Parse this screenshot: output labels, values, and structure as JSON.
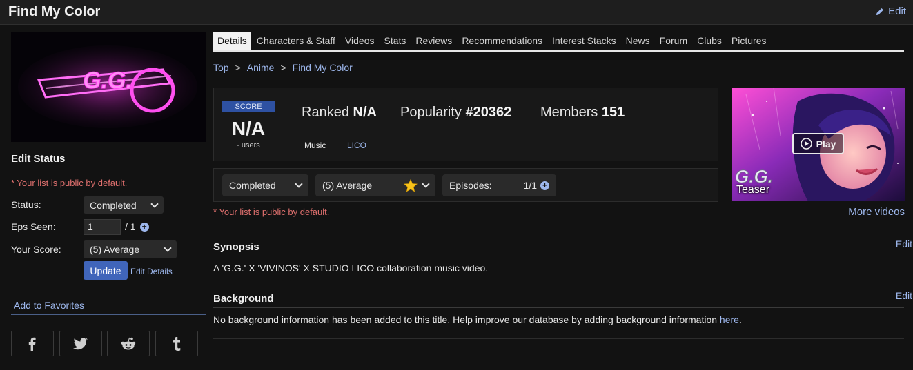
{
  "header": {
    "title": "Find My Color",
    "edit_label": "Edit"
  },
  "sidebar": {
    "edit_status_heading": "Edit Status",
    "public_note": "* Your list is public by default.",
    "status_label": "Status:",
    "status_value": "Completed",
    "eps_label": "Eps Seen:",
    "eps_value": "1",
    "eps_total": "/ 1",
    "score_label": "Your Score:",
    "score_value": "(5) Average",
    "update_label": "Update",
    "edit_details_label": "Edit Details",
    "add_favorites_label": "Add to Favorites",
    "cover_logo_text": "G.G."
  },
  "tabs": [
    {
      "label": "Details",
      "active": true
    },
    {
      "label": "Characters & Staff"
    },
    {
      "label": "Videos"
    },
    {
      "label": "Stats"
    },
    {
      "label": "Reviews"
    },
    {
      "label": "Recommendations"
    },
    {
      "label": "Interest Stacks"
    },
    {
      "label": "News"
    },
    {
      "label": "Forum"
    },
    {
      "label": "Clubs"
    },
    {
      "label": "Pictures"
    }
  ],
  "breadcrumb": {
    "items": [
      "Top",
      "Anime",
      "Find My Color"
    ],
    "separator": ">"
  },
  "score_box": {
    "score_label": "SCORE",
    "score_value": "N/A",
    "users_label": "- users",
    "ranked_label": "Ranked",
    "ranked_value": "N/A",
    "popularity_label": "Popularity",
    "popularity_value": "#20362",
    "members_label": "Members",
    "members_value": "151",
    "type": "Music",
    "studio": "LICO"
  },
  "status_bar": {
    "status_value": "Completed",
    "score_value": "(5) Average",
    "episodes_label": "Episodes:",
    "episodes_value": "1/1",
    "public_note": "* Your list is public by default."
  },
  "video": {
    "play_label": "Play",
    "caption": "Teaser",
    "logo_text": "G.G.",
    "more_videos_label": "More videos"
  },
  "synopsis": {
    "heading": "Synopsis",
    "edit_label": "Edit",
    "text": "A 'G.G.' X 'VIVINOS' X STUDIO LICO collaboration music video."
  },
  "background": {
    "heading": "Background",
    "edit_label": "Edit",
    "text": "No background information has been added to this title. Help improve our database by adding background information ",
    "link_label": "here",
    "suffix": "."
  },
  "colors": {
    "accent": "#9db7ec",
    "button": "#4065ba",
    "score_badge": "#2e51a2",
    "warning": "#e0706e"
  }
}
